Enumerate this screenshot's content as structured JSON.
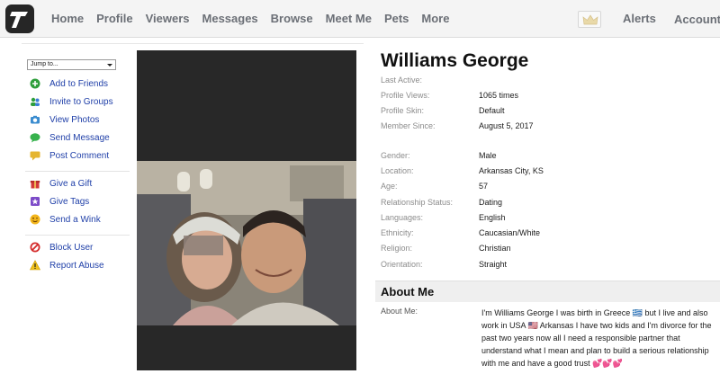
{
  "nav": {
    "items": [
      "Home",
      "Profile",
      "Viewers",
      "Messages",
      "Browse",
      "Meet Me",
      "Pets",
      "More"
    ],
    "alerts": "Alerts",
    "account": "Account"
  },
  "sidebar": {
    "jump_to": "Jump to...",
    "group1": [
      {
        "label": "Add to Friends",
        "icon": "add-friend-icon",
        "color": "#2e9e3b"
      },
      {
        "label": "Invite to Groups",
        "icon": "group-icon",
        "color": "#2e9e3b"
      },
      {
        "label": "View Photos",
        "icon": "camera-icon",
        "color": "#3a8ccf"
      },
      {
        "label": "Send Message",
        "icon": "chat-bubble-icon",
        "color": "#37b24d"
      },
      {
        "label": "Post Comment",
        "icon": "comment-icon",
        "color": "#e5b530"
      }
    ],
    "group2": [
      {
        "label": "Give a Gift",
        "icon": "gift-icon",
        "color": "#d23a3a"
      },
      {
        "label": "Give Tags",
        "icon": "tag-icon",
        "color": "#7c4bc8"
      },
      {
        "label": "Send a Wink",
        "icon": "wink-icon",
        "color": "#f2b51b"
      }
    ],
    "group3": [
      {
        "label": "Block User",
        "icon": "block-icon",
        "color": "#d42a2a"
      },
      {
        "label": "Report Abuse",
        "icon": "warning-icon",
        "color": "#f1c21a"
      }
    ]
  },
  "profile": {
    "name": "Williams George",
    "fields_top": [
      {
        "label": "Last Active:",
        "value": ""
      },
      {
        "label": "Profile Views:",
        "value": "1065 times"
      },
      {
        "label": "Profile Skin:",
        "value": "Default"
      },
      {
        "label": "Member Since:",
        "value": "August 5, 2017"
      }
    ],
    "fields_details": [
      {
        "label": "Gender:",
        "value": "Male"
      },
      {
        "label": "Location:",
        "value": "Arkansas City, KS"
      },
      {
        "label": "Age:",
        "value": "57"
      },
      {
        "label": "Relationship Status:",
        "value": "Dating"
      },
      {
        "label": "Languages:",
        "value": "English"
      },
      {
        "label": "Ethnicity:",
        "value": "Caucasian/White"
      },
      {
        "label": "Religion:",
        "value": "Christian"
      },
      {
        "label": "Orientation:",
        "value": "Straight"
      }
    ]
  },
  "about": {
    "title": "About Me",
    "label": "About Me:",
    "text": "I'm Williams George I was birth in Greece 🇬🇷 but I live and also work in USA 🇺🇸 Arkansas I have two kids and I'm divorce for the past two years now all I need a responsible partner that understand what I mean and plan to build a serious relationship with me and have a good trust 💕💕💕"
  }
}
